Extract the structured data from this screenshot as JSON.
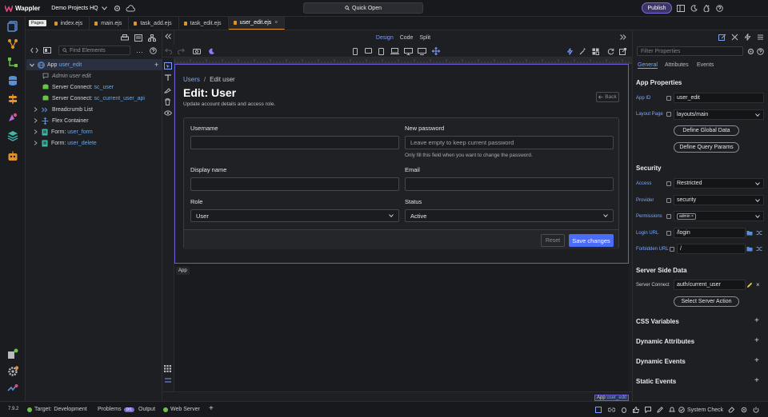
{
  "app": {
    "name": "Wappler",
    "project": "Demo Projects HQ",
    "quick_open": "Quick Open",
    "publish": "Publish"
  },
  "tabs": {
    "pages_badge": "Pages",
    "files": [
      "index.ejs",
      "main.ejs",
      "task_add.ejs",
      "task_edit.ejs",
      "user_edit.ejs"
    ],
    "active": "user_edit.ejs"
  },
  "structure": {
    "find_placeholder": "Find Elements",
    "app_prefix": "App",
    "app_id": "user_edit",
    "admin_label": "Admin user edit",
    "sc1_label": "Server Connect:",
    "sc1_value": "sc_user",
    "sc2_label": "Server Connect:",
    "sc2_value": "sc_current_user_api",
    "breadcrumb": "Breadcrumb List",
    "flex": "Flex Container",
    "form1_label": "Form:",
    "form1_value": "user_form",
    "form2_label": "Form:",
    "form2_value": "user_delete"
  },
  "modes": {
    "design": "Design",
    "code": "Code",
    "split": "Split"
  },
  "page": {
    "crumb_link": "Users",
    "crumb_sep": "/",
    "crumb_current": "Edit user",
    "title": "Edit: User",
    "subtitle": "Update account details and access role.",
    "back": "Back",
    "username_label": "Username",
    "password_label": "New password",
    "password_placeholder": "Leave empty to keep current password",
    "password_help": "Only fill this field when you want to change the password.",
    "display_label": "Display name",
    "email_label": "Email",
    "role_label": "Role",
    "role_value": "User",
    "status_label": "Status",
    "status_value": "Active",
    "reset": "Reset",
    "save": "Save changes",
    "app_tag": "App"
  },
  "canvas_footer": {
    "tag": "App",
    "tag_id": "user_edit"
  },
  "props": {
    "search_placeholder": "Filter Properties",
    "tabs": [
      "General",
      "Attributes",
      "Events"
    ],
    "app_props_title": "App Properties",
    "app_id_label": "App ID",
    "app_id_value": "user_edit",
    "layout_label": "Layout Page",
    "layout_value": "layouts/main",
    "define_global": "Define Global Data",
    "define_query": "Define Query Params",
    "security_title": "Security",
    "access_label": "Access",
    "access_value": "Restricted",
    "provider_label": "Provider",
    "provider_value": "security",
    "permissions_label": "Permissions",
    "permissions_chip": "admin ×",
    "login_label": "Login URL",
    "login_value": "/login",
    "forbidden_label": "Forbidden URL",
    "forbidden_value": "/",
    "ssd_title": "Server Side Data",
    "sc_label": "Server Connect",
    "sc_value": "auth/current_user",
    "select_action": "Select Server Action",
    "css_vars": "CSS Variables",
    "dyn_attrs": "Dynamic Attributes",
    "dyn_events": "Dynamic Events",
    "static_events": "Static Events"
  },
  "status": {
    "version": "7.9.2",
    "target_label": "Target:",
    "target_value": "Development",
    "problems": "Problems",
    "problems_count": "0/1",
    "output": "Output",
    "web_server": "Web Server",
    "system_check": "System Check"
  },
  "colors": {
    "accent": "#7d6cd8",
    "primary_button": "#4a6cf7",
    "link": "#7aa7ff",
    "tab_marker": "#e0932c",
    "ok": "#6ac24a"
  }
}
